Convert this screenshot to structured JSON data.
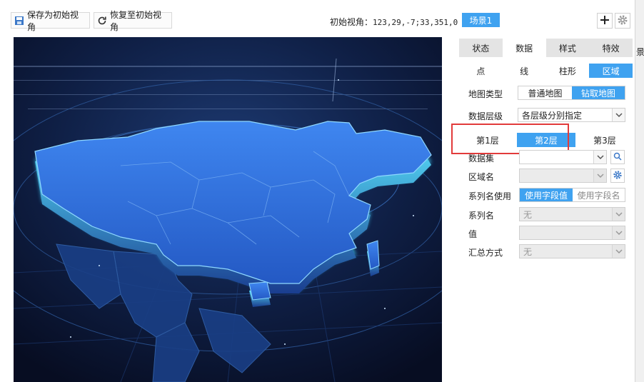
{
  "toolbar": {
    "save_view_label": "保存为初始视角",
    "restore_view_label": "恢复至初始视角",
    "initial_view_prefix": "初始视角：",
    "initial_view_value": "123,29,-7;33,351,0",
    "scene_label": "场景1"
  },
  "right_edge": {
    "text": "景"
  },
  "tabs_main": [
    {
      "label": "状态"
    },
    {
      "label": "数据"
    },
    {
      "label": "样式"
    },
    {
      "label": "特效"
    }
  ],
  "tabs_sub": [
    {
      "label": "点"
    },
    {
      "label": "线"
    },
    {
      "label": "柱形"
    },
    {
      "label": "区域"
    }
  ],
  "form": {
    "map_type_label": "地图类型",
    "map_type_options": [
      "普通地图",
      "钻取地图"
    ],
    "data_level_label": "数据层级",
    "data_level_value": "各层级分别指定",
    "layers": [
      "第1层",
      "第2层",
      "第3层"
    ],
    "dataset_label": "数据集",
    "dataset_value": "",
    "region_label": "区域名",
    "region_value": "",
    "series_use_label": "系列名使用",
    "series_use_options": [
      "使用字段值",
      "使用字段名"
    ],
    "series_name_label": "系列名",
    "series_name_value": "无",
    "value_label": "值",
    "value_value": "",
    "summary_label": "汇总方式",
    "summary_value": "无"
  },
  "colors": {
    "accent": "#3fa2f0",
    "highlight_box": "#e23b3b",
    "map_bg": "#0b1430",
    "map_land": "#2c6fe0",
    "map_glow": "#3fd0ff"
  }
}
